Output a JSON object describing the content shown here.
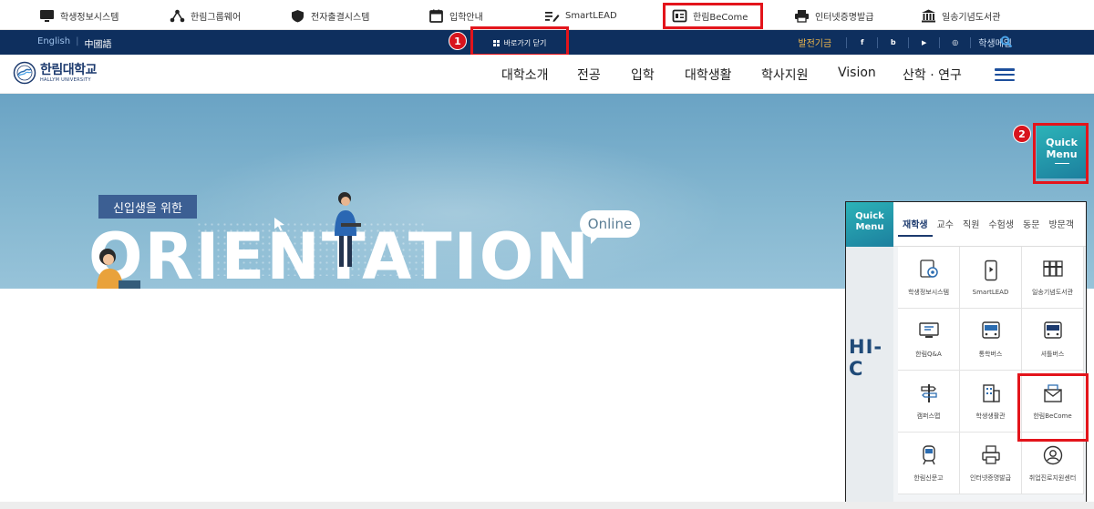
{
  "utility_bar": {
    "items": [
      {
        "label": "학생정보시스템",
        "icon": "monitor-icon"
      },
      {
        "label": "한림그룹웨어",
        "icon": "network-icon"
      },
      {
        "label": "전자출결시스템",
        "icon": "shield-icon"
      },
      {
        "label": "입학안내",
        "icon": "calendar-icon"
      },
      {
        "label": "SmartLEAD",
        "icon": "edit-icon"
      },
      {
        "label": "한림BeCome",
        "icon": "id-card-icon"
      },
      {
        "label": "인터넷증명발급",
        "icon": "printer-icon"
      },
      {
        "label": "일송기념도서관",
        "icon": "library-icon"
      }
    ]
  },
  "dark_bar": {
    "lang_english": "English",
    "lang_chinese": "中國語",
    "skip_label": "바로가기 닫기",
    "fund_label": "발전기금",
    "social": [
      "f",
      "b",
      "▶",
      "◎"
    ],
    "student_mail": "학생메일"
  },
  "annotations": {
    "badge1": "1",
    "badge2": "2"
  },
  "header": {
    "logo_ko": "한림대학교",
    "logo_en": "HALLYM UNIVERSITY",
    "nav": [
      "대학소개",
      "전공",
      "입학",
      "대학생활",
      "학사지원",
      "Vision",
      "산학 · 연구"
    ]
  },
  "hero": {
    "subtitle": "신입생을 위한",
    "title": "ORIENTATION",
    "bubble": "Online"
  },
  "quick_menu_tab": {
    "line1": "Quick",
    "line2": "Menu"
  },
  "quick_panel": {
    "logo_line1": "Quick",
    "logo_line2": "Menu",
    "tabs": [
      "재학생",
      "교수",
      "직원",
      "수험생",
      "동문",
      "방문객"
    ],
    "side_text": "HI-C",
    "cells": [
      {
        "label": "학생정보시스템",
        "icon": "gear-document-icon"
      },
      {
        "label": "SmartLEAD",
        "icon": "smartphone-icon"
      },
      {
        "label": "일송기념도서관",
        "icon": "bookshelf-icon"
      },
      {
        "label": "한림Q&A",
        "icon": "monitor-chat-icon"
      },
      {
        "label": "통학버스",
        "icon": "bus-icon"
      },
      {
        "label": "셔틀버스",
        "icon": "shuttle-bus-icon"
      },
      {
        "label": "캠퍼스맵",
        "icon": "signpost-icon"
      },
      {
        "label": "학생생활관",
        "icon": "building-icon"
      },
      {
        "label": "한림BeCome",
        "icon": "mail-icon"
      },
      {
        "label": "한림신문고",
        "icon": "train-icon"
      },
      {
        "label": "인터넷증명발급",
        "icon": "printer-icon"
      },
      {
        "label": "취업진로지원센터",
        "icon": "user-search-icon"
      }
    ]
  },
  "colors": {
    "navy": "#0e2f5e",
    "highlight_red": "#e3141b",
    "quick_teal": "#2cb3b8"
  }
}
